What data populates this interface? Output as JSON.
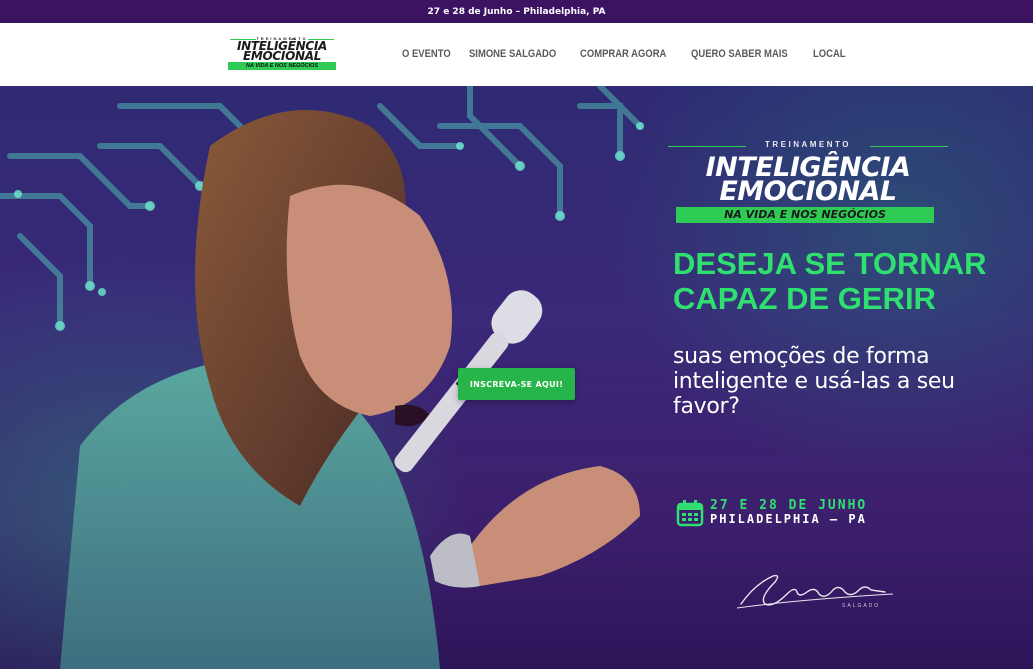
{
  "topbar": {
    "text": "27 e 28 de Junho – Philadelphia, PA"
  },
  "header": {
    "logo": {
      "small": "TREINAMENTO",
      "line1": "INTELIGÊNCIA",
      "line2": "EMOCIONAL",
      "sub": "NA VIDA E NOS NEGÓCIOS"
    },
    "nav": [
      {
        "label": "O EVENTO"
      },
      {
        "label": "SIMONE SALGADO"
      },
      {
        "label": "COMPRAR AGORA"
      },
      {
        "label": "QUERO SABER MAIS"
      },
      {
        "label": "LOCAL"
      }
    ]
  },
  "hero": {
    "eyebrow": "TREINAMENTO",
    "brand_line1": "INTELIGÊNCIA",
    "brand_line2": "EMOCIONAL",
    "brand_sub": "NA VIDA E NOS NEGÓCIOS",
    "headline": "DESEJA SE TORNAR CAPAZ DE GERIR",
    "subline": "suas emoções de forma inteligente e usá-las a seu favor?",
    "cta": "INSCREVA-SE AQUI!",
    "date_line1": "27 E 28 DE JUNHO",
    "date_line2": "PHILADELPHIA – PA",
    "signature": "Simone",
    "signature_sub": "SALGADO"
  },
  "colors": {
    "accent_green": "#2fe070",
    "topbar": "#3c1361",
    "hero_purple": "#3a2878"
  },
  "icons": [
    "calendar-icon"
  ]
}
